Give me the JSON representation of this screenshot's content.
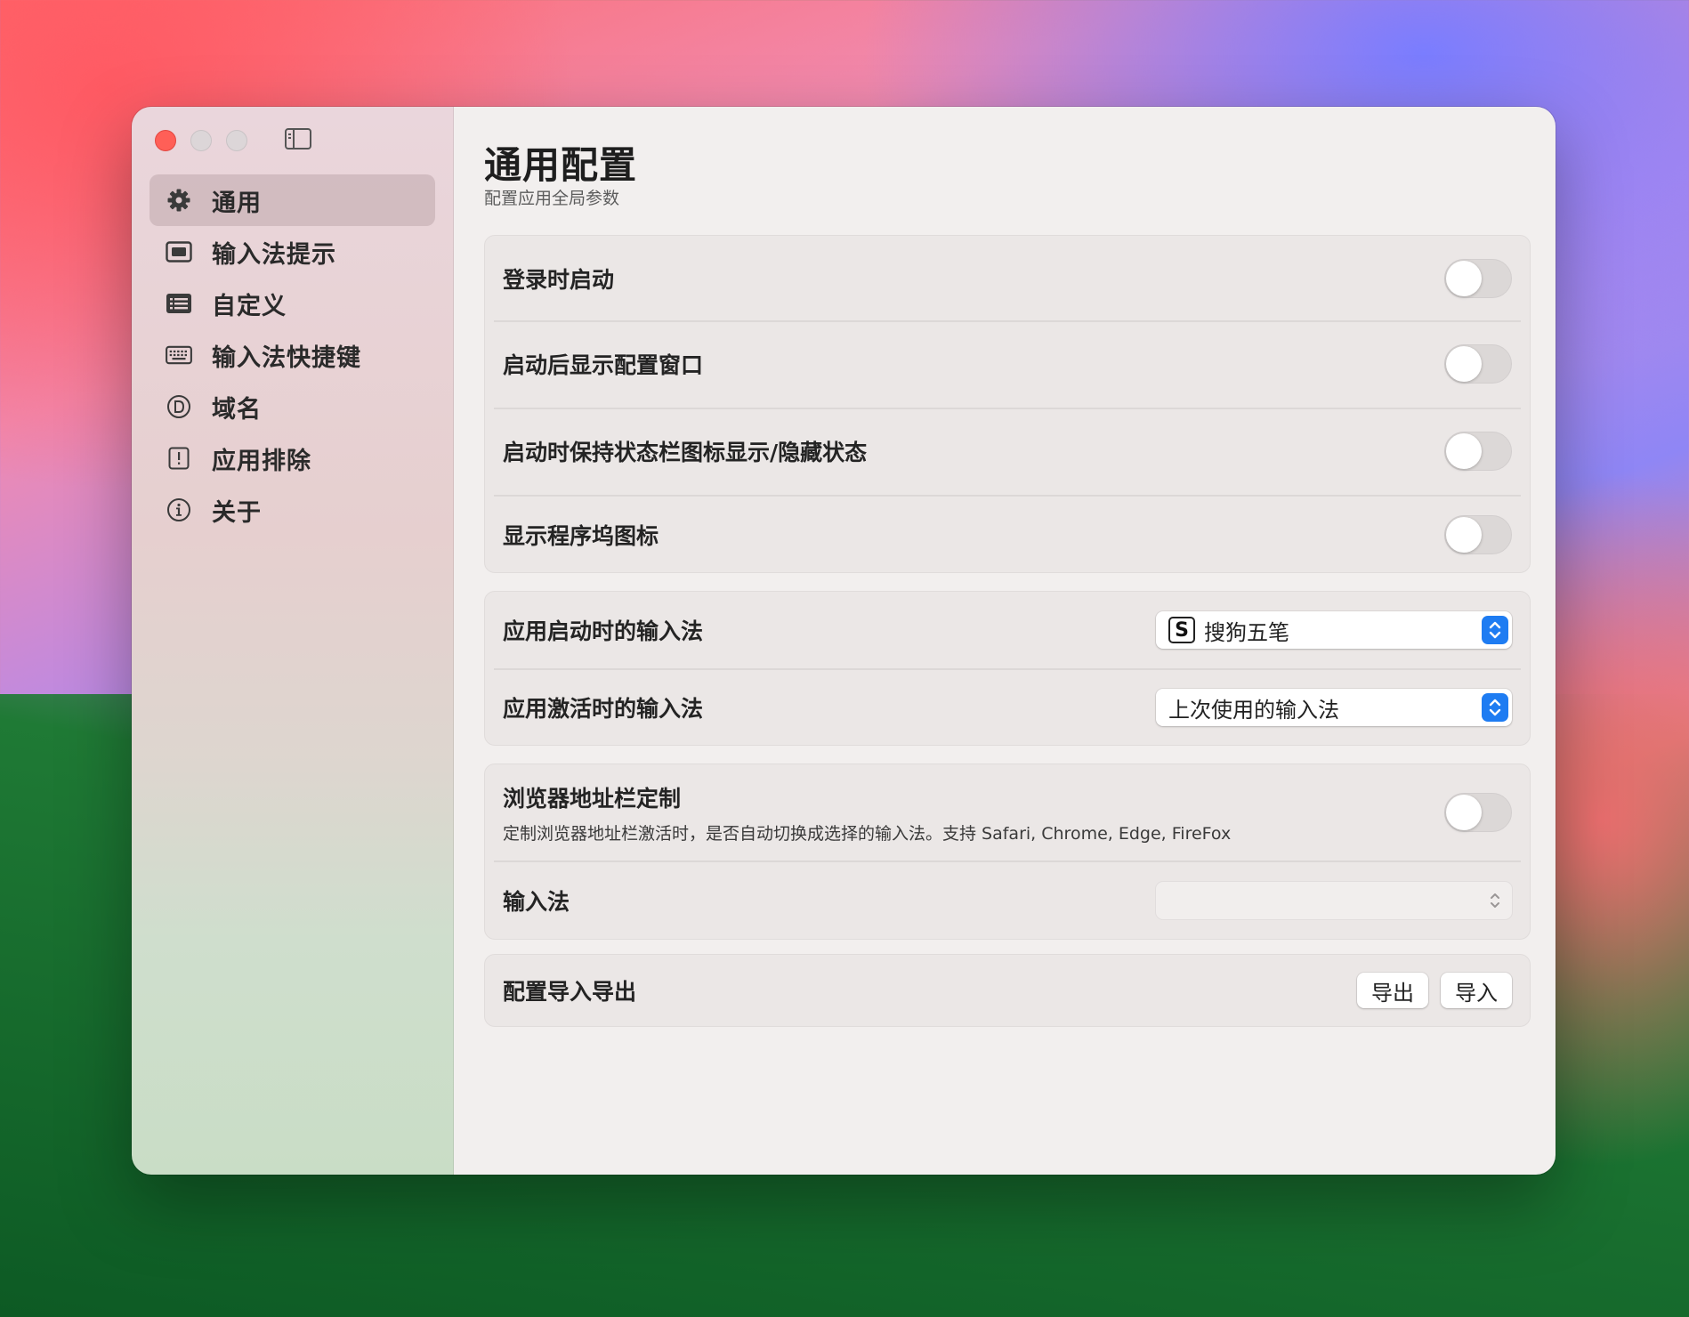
{
  "window": {
    "traffic_lights": [
      "close",
      "minimize",
      "zoom"
    ]
  },
  "sidebar": {
    "items": [
      {
        "label": "通用",
        "icon": "gear-icon",
        "active": true
      },
      {
        "label": "输入法提示",
        "icon": "display-icon",
        "active": false
      },
      {
        "label": "自定义",
        "icon": "list-icon",
        "active": false
      },
      {
        "label": "输入法快捷键",
        "icon": "keyboard-icon",
        "active": false
      },
      {
        "label": "域名",
        "icon": "domain-icon",
        "active": false
      },
      {
        "label": "应用排除",
        "icon": "exclamation-icon",
        "active": false
      },
      {
        "label": "关于",
        "icon": "info-icon",
        "active": false
      }
    ]
  },
  "main": {
    "title": "通用配置",
    "subtitle": "配置应用全局参数",
    "group1": {
      "rows": [
        {
          "label": "登录时启动",
          "toggle": false
        },
        {
          "label": "启动后显示配置窗口",
          "toggle": false
        },
        {
          "label": "启动时保持状态栏图标显示/隐藏状态",
          "toggle": false
        },
        {
          "label": "显示程序坞图标",
          "toggle": false
        }
      ]
    },
    "group2": {
      "rows": [
        {
          "label": "应用启动时的输入法",
          "value": "搜狗五笔",
          "value_icon": "sogou-icon"
        },
        {
          "label": "应用激活时的输入法",
          "value": "上次使用的输入法"
        }
      ]
    },
    "group3": {
      "browser_label": "浏览器地址栏定制",
      "browser_desc": "定制浏览器地址栏激活时，是否自动切换成选择的输入法。支持 Safari, Chrome, Edge, FireFox",
      "browser_toggle": false,
      "ime_label": "输入法",
      "ime_value": ""
    },
    "group4": {
      "label": "配置导入导出",
      "export_label": "导出",
      "import_label": "导入"
    }
  },
  "colors": {
    "accent": "#1e7cf2",
    "close": "#ff5f57",
    "content_bg": "#f2efee",
    "group_bg": "#ebe7e6"
  }
}
